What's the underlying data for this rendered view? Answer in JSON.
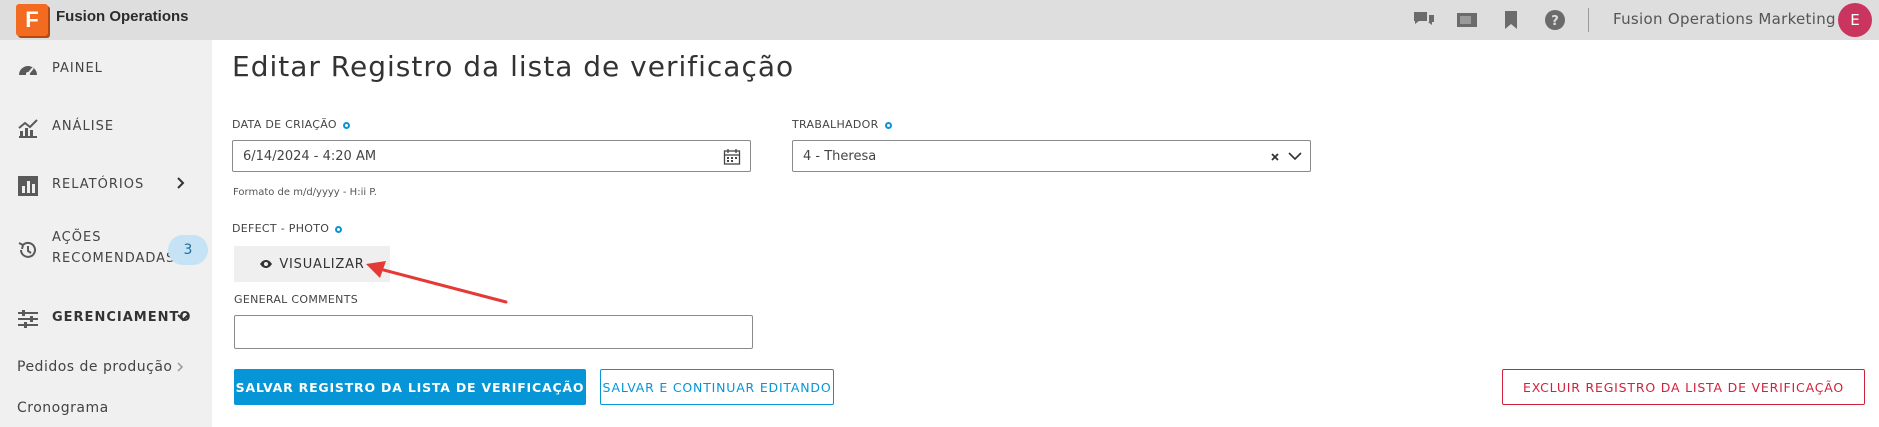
{
  "topbar": {
    "logo_letter": "F",
    "app_name": "Fusion Operations",
    "icons": [
      "chat-icon",
      "screen-icon",
      "bookmark-icon",
      "help-icon"
    ],
    "company": "Fusion Operations Marketing",
    "avatar_letter": "E"
  },
  "sidebar": {
    "items": [
      {
        "label": "PAINEL",
        "icon": "gauge-icon"
      },
      {
        "label": "ANÁLISE",
        "icon": "line-chart-icon"
      },
      {
        "label": "RELATÓRIOS",
        "icon": "bar-chart-icon"
      },
      {
        "label_line1": "AÇÕES",
        "label_line2": "RECOMENDADAS",
        "icon": "history-icon",
        "badge": "3"
      },
      {
        "label": "GERENCIAMENTO",
        "icon": "sliders-icon"
      }
    ],
    "subitems": [
      {
        "label": "Pedidos de produção"
      },
      {
        "label": "Cronograma"
      }
    ]
  },
  "main": {
    "title": "Editar Registro da lista de verificação",
    "created_label": "DATA DE CRIAÇÃO",
    "created_value": "6/14/2024 - 4:20 AM",
    "created_helper": "Formato de m/d/yyyy - H:ii P.",
    "worker_label": "TRABALHADOR",
    "worker_value": "4 - Theresa",
    "defect_label": "DEFECT - PHOTO",
    "view_label": "VISUALIZAR",
    "comments_label": "GENERAL COMMENTS",
    "comments_value": "",
    "save_label": "SALVAR REGISTRO DA LISTA DE VERIFICAÇÃO",
    "save_continue_label": "SALVAR E CONTINUAR EDITANDO",
    "delete_label": "EXCLUIR REGISTRO DA LISTA DE VERIFICAÇÃO"
  },
  "colors": {
    "brand": "#f26b21",
    "accent": "#0696d7",
    "danger": "#d1213c",
    "annotation_arrow": "#e53935"
  }
}
